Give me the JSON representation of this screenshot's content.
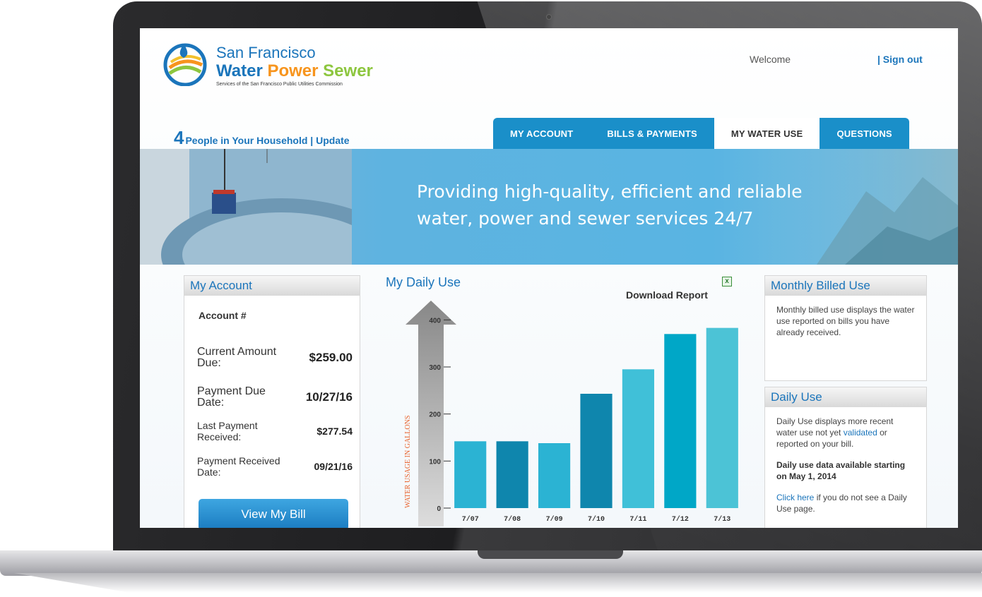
{
  "brand": {
    "line1": "San Francisco",
    "word_water": "Water",
    "word_power": "Power",
    "word_sewer": "Sewer",
    "tagline": "Services of the San Francisco Public Utilities Commission"
  },
  "header": {
    "welcome": "Welcome",
    "signout": "| Sign out"
  },
  "household": {
    "count": "4",
    "text": "People in Your Household | Update"
  },
  "tabs": [
    {
      "label": "MY ACCOUNT",
      "active": false
    },
    {
      "label": "BILLS & PAYMENTS",
      "active": false
    },
    {
      "label": "MY WATER USE",
      "active": true
    },
    {
      "label": "QUESTIONS",
      "active": false
    }
  ],
  "banner": {
    "line1": "Providing high-quality, efficient and reliable",
    "line2": "water, power and sewer services 24/7"
  },
  "account": {
    "title": "My Account",
    "account_label": "Account #",
    "rows": [
      {
        "label": "Current Amount Due:",
        "value": "$259.00"
      },
      {
        "label": "Payment Due Date:",
        "value": "10/27/16"
      },
      {
        "label": "Last Payment Received:",
        "value": "$277.54"
      },
      {
        "label": "Payment Received Date:",
        "value": "09/21/16"
      }
    ],
    "view_bill": "View My Bill"
  },
  "daily_use": {
    "title": "My Daily Use",
    "download": "Download Report"
  },
  "chart_data": {
    "type": "bar",
    "categories": [
      "7/07",
      "7/08",
      "7/09",
      "7/10",
      "7/11",
      "7/12",
      "7/13"
    ],
    "values": [
      142,
      142,
      138,
      243,
      295,
      370,
      383
    ],
    "ylabel": "WATER USAGE IN GALLONS",
    "yticks": [
      0,
      100,
      200,
      300,
      400
    ],
    "ylim": [
      0,
      420
    ],
    "colors": [
      "#2bb3d3",
      "#0f86ad",
      "#2bb3d3",
      "#0f86ad",
      "#40c0d8",
      "#00a7c7",
      "#4cc3d6"
    ]
  },
  "monthly": {
    "title": "Monthly Billed Use",
    "text": "Monthly billed use displays the water use reported on bills you have already received."
  },
  "daily_side": {
    "title": "Daily Use",
    "text_before": "Daily Use displays more recent water use not yet",
    "link_validated": "validated",
    "text_after": "or reported on your bill.",
    "bold": "Daily use data available starting on May 1, 2014",
    "link_click": "Click here",
    "text_click": "if you do not see a Daily Use page."
  },
  "colors": {
    "brand_blue": "#1b75bb",
    "brand_orange": "#f7941d",
    "brand_green": "#8dc63f",
    "tab_blue": "#1a8fc9"
  }
}
